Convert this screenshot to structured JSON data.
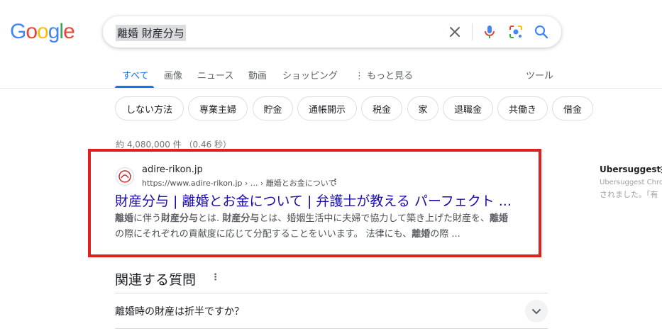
{
  "logo": {
    "letters": [
      {
        "char": "G",
        "color": "#4285F4"
      },
      {
        "char": "o",
        "color": "#EA4335"
      },
      {
        "char": "o",
        "color": "#FBBC05"
      },
      {
        "char": "g",
        "color": "#4285F4"
      },
      {
        "char": "l",
        "color": "#34A853"
      },
      {
        "char": "e",
        "color": "#EA4335"
      }
    ]
  },
  "search": {
    "query": "離婚 財産分与",
    "icons": {
      "clear": "close-icon",
      "voice": "microphone-icon",
      "lens": "lens-icon",
      "search": "search-icon"
    }
  },
  "tabs": {
    "all": "すべて",
    "images": "画像",
    "news": "ニュース",
    "videos": "動画",
    "shopping": "ショッピング",
    "more": "⋮ もっと見る",
    "tools": "ツール"
  },
  "chips": [
    "しない方法",
    "専業主婦",
    "貯金",
    "通帳開示",
    "税金",
    "家",
    "退職金",
    "共働き",
    "借金"
  ],
  "stats": "約 4,080,000 件 （0.46 秒）",
  "result": {
    "site_name": "adire-rikon.jp",
    "url": "https://www.adire-rikon.jp › ... › 離婚とお金について",
    "title": "財産分与 | 離婚とお金について | 弁護士が教える パーフェクト ...",
    "snippet_line1": [
      {
        "text": "離婚",
        "bold": true
      },
      {
        "text": "に伴う",
        "bold": false
      },
      {
        "text": "財産分与",
        "bold": true
      },
      {
        "text": "とは. ",
        "bold": false
      },
      {
        "text": "財産分与",
        "bold": true
      },
      {
        "text": "とは、婚姻生活中に夫婦で協力して築き上げた財産を、",
        "bold": false
      },
      {
        "text": "離婚",
        "bold": true
      }
    ],
    "snippet_line2": [
      {
        "text": "の際にそれぞれの貢献度に応じて分配することをいいます。 法律にも、",
        "bold": false
      },
      {
        "text": "離婚",
        "bold": true
      },
      {
        "text": "の際 ...",
        "bold": false
      }
    ]
  },
  "side_panel": {
    "title": "Ubersuggest拡",
    "line1": "Ubersuggest Chro",
    "line2": "されました。「有"
  },
  "related": {
    "heading": "関連する質問",
    "questions": [
      "離婚時の財産は折半ですか？"
    ]
  },
  "colors": {
    "link": "#1a0dab",
    "accent": "#1a73e8",
    "highlight_border": "#e0201f"
  }
}
